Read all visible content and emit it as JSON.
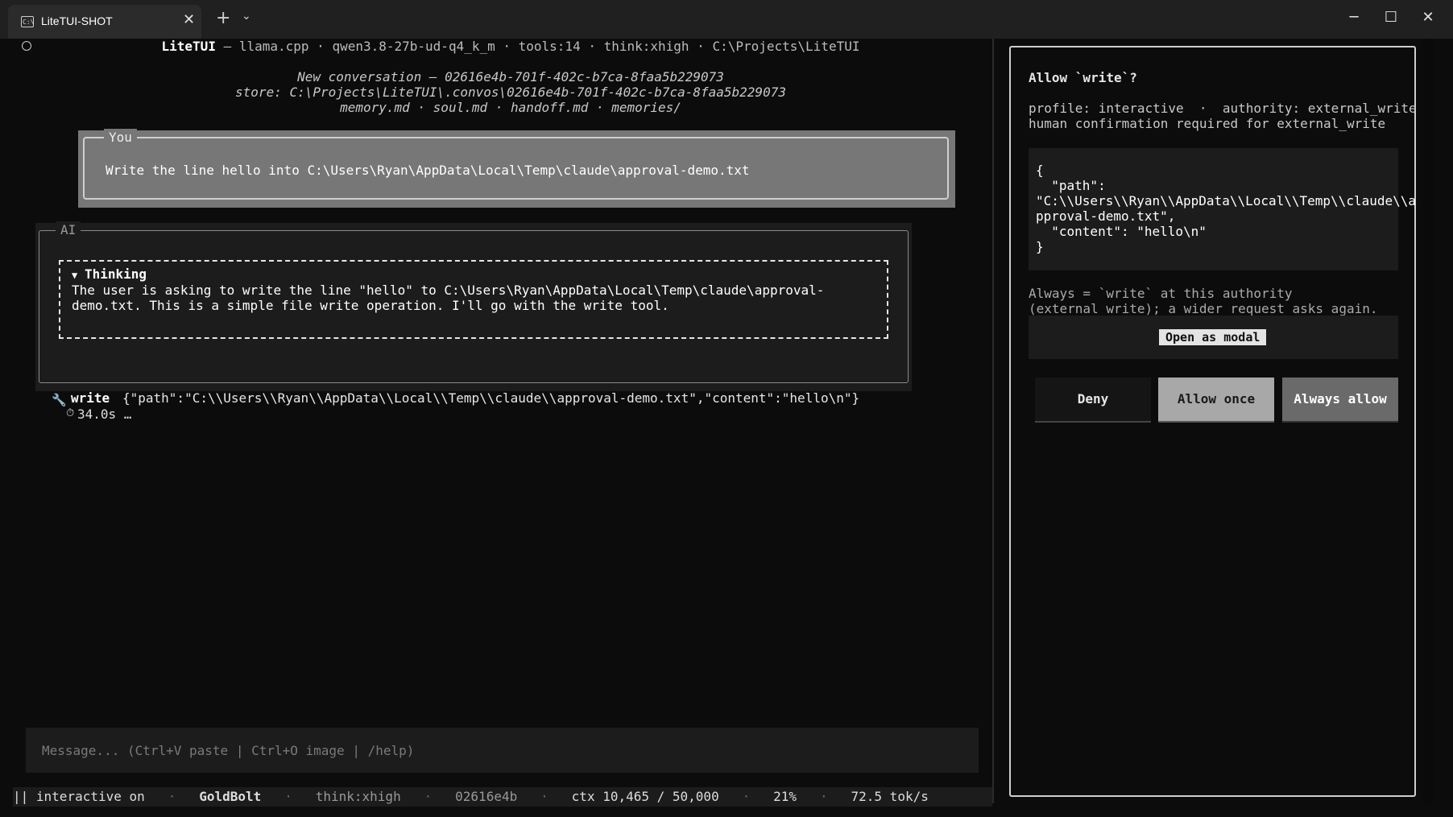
{
  "window": {
    "tab_title": "LiteTUI-SHOT",
    "tab_icon_text": "C:\\",
    "close_glyph": "✕",
    "new_tab_glyph": "+",
    "dropdown_glyph": "⌄",
    "minimize_glyph": "─",
    "maximize_glyph": "☐",
    "window_close_glyph": "✕"
  },
  "header": {
    "app": "LiteTUI",
    "rest": " — llama.cpp · qwen3.8-27b-ud-q4_k_m · tools:14 · think:xhigh · C:\\Projects\\LiteTUI"
  },
  "conversation": {
    "title_line": "New conversation — 02616e4b-701f-402c-b7ca-8faa5b229073",
    "store_line": "store: C:\\Projects\\LiteTUI\\.convos\\02616e4b-701f-402c-b7ca-8faa5b229073",
    "files_line": "memory.md · soul.md · handoff.md · memories/"
  },
  "you_block": {
    "label": "You",
    "text": "Write the line hello into C:\\Users\\Ryan\\AppData\\Local\\Temp\\claude\\approval-demo.txt"
  },
  "ai_block": {
    "label": "AI",
    "thinking_arrow": "▼",
    "thinking_title": "Thinking",
    "thinking_text": "The user is asking to write the line \"hello\" to C:\\Users\\Ryan\\AppData\\Local\\Temp\\claude\\approval-demo.txt. This is a simple file write operation. I'll go with the write tool."
  },
  "tool_call": {
    "icon": "🔧",
    "name": "write",
    "args": "{\"path\":\"C:\\\\Users\\\\Ryan\\\\AppData\\\\Local\\\\Temp\\\\claude\\\\approval-demo.txt\",\"content\":\"hello\\n\"}",
    "timer_icon": "⏱",
    "elapsed": "34.0s …"
  },
  "input": {
    "placeholder": "Message... (Ctrl+V paste | Ctrl+O image | /help)"
  },
  "status_bar": {
    "pause": "||",
    "mode": "interactive on",
    "sep": "·",
    "model": "GoldBolt",
    "think": "think:xhigh",
    "session": "02616e4b",
    "ctx": "ctx 10,465 / 50,000",
    "pct": "21%",
    "speed": "72.5 tok/s"
  },
  "approval": {
    "title": "Allow `write`?",
    "profile_text": "profile: interactive  ·  authority: external_write\nhuman confirmation required for external_write",
    "json_text": "{\n  \"path\":\n\"C:\\\\Users\\\\Ryan\\\\AppData\\\\Local\\\\Temp\\\\claude\\\\a\npproval-demo.txt\",\n  \"content\": \"hello\\n\"\n}",
    "always_note": "Always = `write` at this authority\n(external_write); a wider request asks again.",
    "open_modal": "Open as modal",
    "deny": "Deny",
    "allow_once": "Allow once",
    "always_allow": "Always allow"
  }
}
